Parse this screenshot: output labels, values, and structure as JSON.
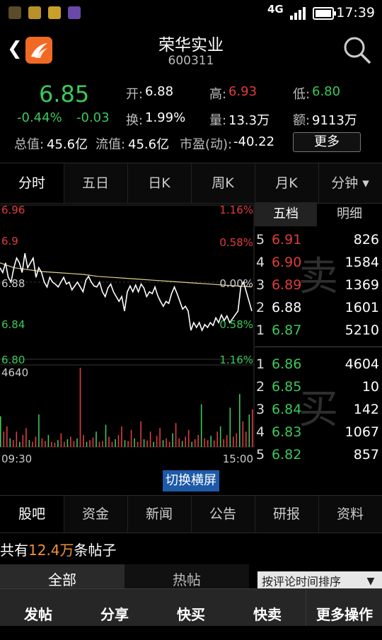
{
  "status_bar": {
    "network": "4G",
    "time": "17:39"
  },
  "header": {
    "title": "荣华实业",
    "code": "600311"
  },
  "quote": {
    "price": "6.85",
    "change_pct": "-0.44%",
    "change": "-0.03",
    "open_label": "开:",
    "open": "6.88",
    "high_label": "高:",
    "high": "6.93",
    "low_label": "低:",
    "low": "6.80",
    "turnover_label": "换:",
    "turnover": "1.99%",
    "volume_label": "量:",
    "volume": "13.3万",
    "amount_label": "额:",
    "amount": "9113万",
    "total_mv_label": "总值:",
    "total_mv": "45.6亿",
    "float_mv_label": "流值:",
    "float_mv": "45.6亿",
    "pe_label": "市盈(动):",
    "pe": "-40.22",
    "more_label": "更多"
  },
  "chart_tabs": [
    "分时",
    "五日",
    "日K",
    "周K",
    "月K",
    "分钟 ▾"
  ],
  "chart_data": {
    "type": "line",
    "y_ticks_left": [
      "6.96",
      "6.9",
      "6.88",
      "6.84",
      "6.80"
    ],
    "y_ticks_right": [
      "1.16%",
      "0.58%",
      "0.00%",
      "0.58%",
      "1.16%"
    ],
    "volume_max_label": "4640",
    "x_labels": [
      "09:30",
      "15:00"
    ],
    "ylim": [
      6.8,
      6.96
    ],
    "price_series": [
      6.895,
      6.89,
      6.9,
      6.885,
      6.88,
      6.895,
      6.905,
      6.9,
      6.89,
      6.91,
      6.895,
      6.9,
      6.905,
      6.885,
      6.895,
      6.89,
      6.88,
      6.875,
      6.885,
      6.88,
      6.878,
      6.875,
      6.88,
      6.885,
      6.878,
      6.88,
      6.872,
      6.876,
      6.88,
      6.875,
      6.87,
      6.882,
      6.886,
      6.88,
      6.876,
      6.875,
      6.88,
      6.87,
      6.865,
      6.874,
      6.878,
      6.87,
      6.865,
      6.86,
      6.865,
      6.85,
      6.87,
      6.876,
      6.87,
      6.877,
      6.87,
      6.878,
      6.874,
      6.865,
      6.87,
      6.868,
      6.875,
      6.866,
      6.86,
      6.855,
      6.86,
      6.858,
      6.868,
      6.875,
      6.868,
      6.86,
      6.852,
      6.855,
      6.85,
      6.83,
      6.838,
      6.833,
      6.838,
      6.83,
      6.836,
      6.833,
      6.838,
      6.835,
      6.843,
      6.838,
      6.846,
      6.84,
      6.845,
      6.838,
      6.842,
      6.846,
      6.85,
      6.875,
      6.88,
      6.87,
      6.86,
      6.85
    ],
    "avg_series": [
      6.9,
      6.895,
      6.893,
      6.891,
      6.89,
      6.889,
      6.888,
      6.886,
      6.885,
      6.884,
      6.883,
      6.882,
      6.881,
      6.88,
      6.879,
      6.878,
      6.877,
      6.876,
      6.875
    ],
    "volume_series": [
      1800,
      900,
      1200,
      500,
      400,
      900,
      300,
      700,
      1100,
      400,
      300,
      600,
      1900,
      500,
      350,
      700,
      300,
      250,
      400,
      800,
      300,
      450,
      600,
      350,
      500,
      4640,
      700,
      300,
      400,
      550,
      900,
      300,
      350,
      1300,
      600,
      300,
      450,
      700,
      1200,
      400,
      350,
      1000,
      500,
      300,
      1500,
      450,
      380,
      900,
      300,
      650,
      1100,
      400,
      500,
      300,
      800,
      1400,
      500,
      350,
      600,
      1000,
      300,
      450,
      700,
      2500,
      500,
      400,
      650,
      380,
      900,
      1200,
      450,
      700,
      2300,
      600,
      800,
      3100,
      1500,
      900,
      1900,
      2200
    ]
  },
  "orderbook": {
    "tabs": [
      "五档",
      "明细"
    ],
    "sell_watermark": "卖",
    "buy_watermark": "买",
    "sell": [
      {
        "level": "5",
        "price": "6.91",
        "vol": "826",
        "color": "red"
      },
      {
        "level": "4",
        "price": "6.90",
        "vol": "1584",
        "color": "red"
      },
      {
        "level": "3",
        "price": "6.89",
        "vol": "1369",
        "color": "red"
      },
      {
        "level": "2",
        "price": "6.88",
        "vol": "1601",
        "color": "white"
      },
      {
        "level": "1",
        "price": "6.87",
        "vol": "5210",
        "color": "green"
      }
    ],
    "buy": [
      {
        "level": "1",
        "price": "6.86",
        "vol": "4604",
        "color": "green"
      },
      {
        "level": "2",
        "price": "6.85",
        "vol": "10",
        "color": "green"
      },
      {
        "level": "3",
        "price": "6.84",
        "vol": "142",
        "color": "green"
      },
      {
        "level": "4",
        "price": "6.83",
        "vol": "1067",
        "color": "green"
      },
      {
        "level": "5",
        "price": "6.82",
        "vol": "857",
        "color": "green"
      }
    ]
  },
  "switch_landscape": "切换横屏",
  "info_tabs": [
    "股吧",
    "资金",
    "新闻",
    "公告",
    "研报",
    "资料"
  ],
  "posts": {
    "prefix": "共有",
    "count": "12.4万",
    "suffix": "条帖子"
  },
  "filters": {
    "all": "全部",
    "hot": "热帖",
    "sort": "按评论时间排序"
  },
  "bottom_actions": [
    "发帖",
    "分享",
    "快买",
    "快卖",
    "更多操作"
  ],
  "colors": {
    "red": "#e03c3c",
    "green": "#3cc85a",
    "avg_line": "#e6d08a",
    "accent_blue": "#1d5aa8"
  }
}
